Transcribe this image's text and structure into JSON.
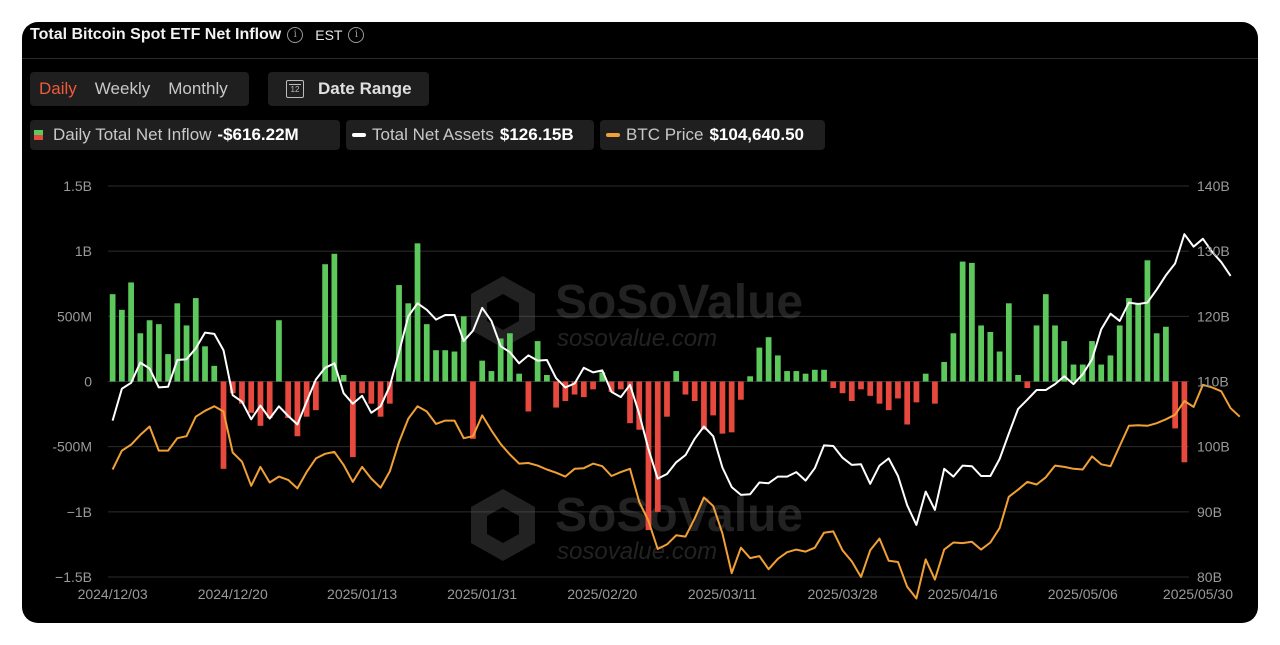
{
  "header": {
    "title": "Total Bitcoin Spot ETF Net Inflow",
    "timezone": "EST"
  },
  "tabs": [
    {
      "label": "Daily",
      "active": true
    },
    {
      "label": "Weekly",
      "active": false
    },
    {
      "label": "Monthly",
      "active": false
    }
  ],
  "date_range": {
    "label": "Date Range",
    "icon": "calendar-icon",
    "icon_text": "12"
  },
  "legend": [
    {
      "label": "Daily Total Net Inflow",
      "value": "-$616.22M",
      "color_pos": "#5dc95d",
      "color_neg": "#e8493e"
    },
    {
      "label": "Total Net Assets",
      "value": "$126.15B",
      "color": "#ffffff"
    },
    {
      "label": "BTC Price",
      "value": "$104,640.50",
      "color": "#f0a035"
    }
  ],
  "watermark": {
    "brand": "SoSoValue",
    "url": "sosovalue.com"
  },
  "colors": {
    "positive": "#5dc95d",
    "negative": "#e8493e",
    "assets": "#ffffff",
    "price": "#f0a035",
    "grid": "#2c2c2c",
    "axis_text": "#9a9a9a"
  },
  "chart_data": {
    "type": "bar",
    "y_left": {
      "range": [
        -1.5,
        1.5
      ],
      "unit": "B",
      "tick_labels": [
        "1.5B",
        "1B",
        "500M",
        "0",
        "-500M",
        "−1B",
        "−1.5B"
      ]
    },
    "y_right": {
      "range": [
        80,
        140
      ],
      "unit": "B",
      "tick_labels": [
        "140B",
        "130B",
        "120B",
        "110B",
        "100B",
        "90B",
        "80B"
      ]
    },
    "x_tick_labels": [
      "2024/12/03",
      "2024/12/20",
      "2025/01/13",
      "2025/01/31",
      "2025/02/20",
      "2025/03/11",
      "2025/03/28",
      "2025/04/16",
      "2025/05/06",
      "2025/05/30"
    ],
    "x_tick_index": [
      0,
      13,
      27,
      40,
      53,
      66,
      79,
      92,
      105,
      123
    ],
    "grid": true,
    "series": [
      {
        "name": "Daily Total Net Inflow",
        "type": "bar",
        "axis": "left",
        "values": [
          0.67,
          0.55,
          0.76,
          0.37,
          0.47,
          0.44,
          0.21,
          0.6,
          0.43,
          0.64,
          0.27,
          0.12,
          -0.67,
          -0.09,
          -0.17,
          -0.24,
          -0.34,
          -0.28,
          0.47,
          -0.28,
          -0.42,
          -0.27,
          -0.22,
          0.9,
          0.98,
          0.05,
          -0.58,
          -0.09,
          -0.17,
          -0.27,
          -0.17,
          0.74,
          0.6,
          1.06,
          0.44,
          0.24,
          0.24,
          0.23,
          0.5,
          -0.44,
          0.16,
          0.08,
          0.33,
          0.37,
          0.06,
          -0.23,
          0.31,
          0.05,
          -0.2,
          -0.15,
          -0.1,
          -0.12,
          -0.06,
          0.07,
          -0.08,
          -0.06,
          -0.32,
          -0.37,
          -1.14,
          -1.0,
          -0.27,
          0.08,
          -0.1,
          -0.15,
          -0.37,
          -0.26,
          -0.4,
          -0.39,
          -0.14,
          0.04,
          0.26,
          0.34,
          0.2,
          0.08,
          0.08,
          0.06,
          0.09,
          0.09,
          -0.05,
          -0.09,
          -0.15,
          -0.06,
          -0.11,
          -0.17,
          -0.22,
          -0.13,
          -0.33,
          -0.16,
          0.06,
          -0.17,
          0.15,
          0.37,
          0.92,
          0.91,
          0.43,
          0.38,
          0.23,
          0.6,
          0.05,
          -0.05,
          0.43,
          0.67,
          0.43,
          0.31,
          0.13,
          0.13,
          0.31,
          0.13,
          0.2,
          0.43,
          0.64,
          0.6,
          0.93,
          0.37,
          0.42,
          -0.36,
          -0.62
        ]
      },
      {
        "name": "Total Net Assets",
        "type": "line",
        "axis": "right",
        "values": [
          104,
          108.9,
          109.8,
          112.9,
          112,
          109.1,
          109.2,
          113.3,
          113.4,
          115.1,
          117.5,
          117.3,
          114.8,
          107.9,
          106.9,
          104.2,
          106.3,
          104.3,
          106.2,
          104.7,
          103.4,
          106.9,
          110.3,
          112.1,
          112.8,
          108.2,
          106.6,
          107.8,
          105.2,
          106.2,
          109.3,
          114.5,
          120,
          122,
          121,
          119.5,
          120.2,
          120.2,
          116.2,
          117.8,
          121.3,
          119.3,
          115.4,
          114.5,
          112.8,
          114,
          113.2,
          113.3,
          110.5,
          109.1,
          109.7,
          112.1,
          111.4,
          111.7,
          108.4,
          107.6,
          109.5,
          105,
          99.6,
          95.1,
          95.8,
          97.6,
          98.7,
          101.2,
          103.1,
          101.6,
          96.8,
          93.8,
          92.6,
          92.7,
          94.5,
          94.4,
          95.4,
          95.4,
          96.1,
          94.8,
          96.7,
          100.2,
          100.1,
          98.3,
          97.2,
          97.3,
          94.3,
          97.1,
          98.2,
          95.5,
          91,
          88,
          93.1,
          90.3,
          96.6,
          95.4,
          97.1,
          97,
          95.5,
          95.5,
          98.1,
          102,
          105.8,
          107.2,
          108.7,
          108.7,
          109.6,
          110.8,
          109.6,
          111.1,
          113.4,
          118,
          120.4,
          119.3,
          122.1,
          121.9,
          122.1,
          124.1,
          126.3,
          128.1,
          132.6,
          130.7,
          131.9,
          129.9,
          128.3,
          126.2
        ]
      },
      {
        "name": "BTC Price",
        "type": "line",
        "axis": "right",
        "values": [
          96.5,
          99.4,
          100.3,
          101.8,
          103.1,
          99.4,
          99.4,
          101.3,
          101.6,
          104.6,
          105.5,
          106.2,
          105.4,
          99.1,
          97.7,
          94,
          96.9,
          94.5,
          95.4,
          94.9,
          93.6,
          96.1,
          98.2,
          98.9,
          99.2,
          97.2,
          94.6,
          96.9,
          95.1,
          93.7,
          96.2,
          100.7,
          104.3,
          106.2,
          105.4,
          103.5,
          104,
          104,
          101.3,
          101.6,
          104.8,
          102.5,
          100.4,
          98.8,
          97.4,
          97.5,
          97.1,
          96.5,
          96,
          95.4,
          96.6,
          96.7,
          97.4,
          97,
          95.5,
          96.1,
          96.6,
          91.5,
          88.6,
          84.3,
          85,
          86.4,
          86.2,
          89,
          92.2,
          90.9,
          86.7,
          80.6,
          84.5,
          82.9,
          83.2,
          81.2,
          82.8,
          83.8,
          84.2,
          83.9,
          84.5,
          86.8,
          87,
          84.1,
          82.4,
          80,
          84.1,
          85.9,
          82.5,
          82.3,
          78.5,
          76.7,
          82.7,
          79.6,
          84.2,
          85.3,
          85.2,
          85.4,
          84.2,
          85.3,
          87.5,
          92.3,
          93.4,
          94.6,
          94.2,
          95.3,
          97.1,
          96.9,
          96.6,
          96.5,
          98.5,
          97.3,
          97,
          100.1,
          103.2,
          103.3,
          103.2,
          103.6,
          104.2,
          104.9,
          107,
          106.1,
          109.5,
          109.1,
          108.5,
          105.9,
          104.6
        ]
      }
    ]
  }
}
